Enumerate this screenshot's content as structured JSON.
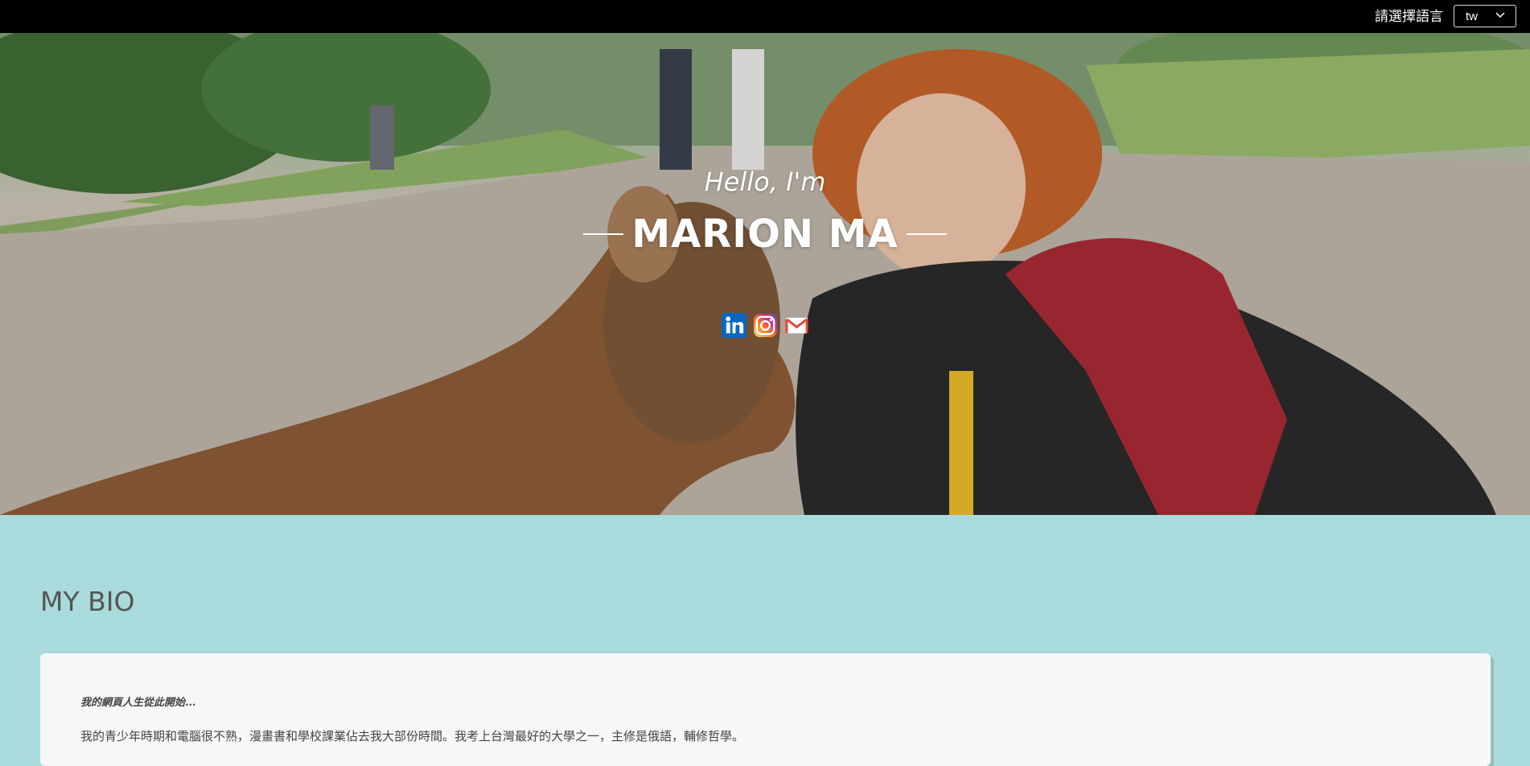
{
  "header": {
    "language_label": "請選擇語言",
    "language_value": "tw"
  },
  "hero": {
    "greeting": "Hello, I'm",
    "name": "MARION MA",
    "socials": [
      {
        "icon": "linkedin-icon",
        "color": "#0a66c2"
      },
      {
        "icon": "instagram-icon",
        "color": "#e1306c"
      },
      {
        "icon": "gmail-icon",
        "color": "#ea4335"
      }
    ]
  },
  "bio": {
    "title": "MY BIO",
    "intro": "我的網頁人生從此開始...",
    "paragraph": "我的青少年時期和電腦很不熟，漫畫書和學校課業佔去我大部份時間。我考上台灣最好的大學之一，主修是俄語，輔修哲學。"
  },
  "colors": {
    "topbar": "#000000",
    "page_background": "#a9dadc",
    "card_background": "#f7f7f7"
  }
}
